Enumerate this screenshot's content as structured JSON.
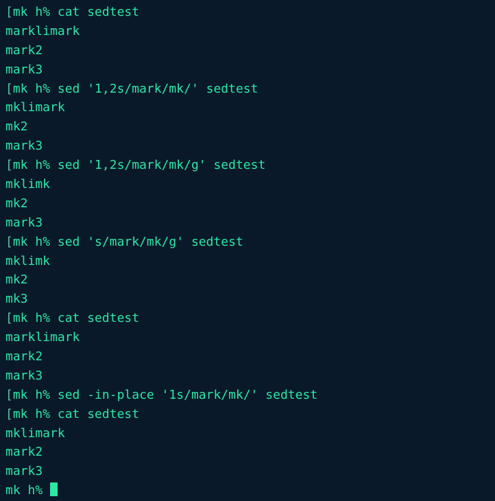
{
  "terminal": {
    "prompt_bracket": "[",
    "prompt_text": "mk h%",
    "lines": [
      {
        "type": "prompt",
        "command": "cat sedtest"
      },
      {
        "type": "output",
        "text": "marklimark"
      },
      {
        "type": "output",
        "text": "mark2"
      },
      {
        "type": "output",
        "text": "mark3"
      },
      {
        "type": "prompt",
        "command": "sed '1,2s/mark/mk/' sedtest"
      },
      {
        "type": "output",
        "text": "mklimark"
      },
      {
        "type": "output",
        "text": "mk2"
      },
      {
        "type": "output",
        "text": "mark3"
      },
      {
        "type": "prompt",
        "command": "sed '1,2s/mark/mk/g' sedtest"
      },
      {
        "type": "output",
        "text": "mklimk"
      },
      {
        "type": "output",
        "text": "mk2"
      },
      {
        "type": "output",
        "text": "mark3"
      },
      {
        "type": "prompt",
        "command": "sed 's/mark/mk/g' sedtest"
      },
      {
        "type": "output",
        "text": "mklimk"
      },
      {
        "type": "output",
        "text": "mk2"
      },
      {
        "type": "output",
        "text": "mk3"
      },
      {
        "type": "prompt",
        "command": "cat sedtest"
      },
      {
        "type": "output",
        "text": "marklimark"
      },
      {
        "type": "output",
        "text": "mark2"
      },
      {
        "type": "output",
        "text": "mark3"
      },
      {
        "type": "prompt",
        "command": "sed -in-place '1s/mark/mk/' sedtest"
      },
      {
        "type": "prompt",
        "command": "cat sedtest"
      },
      {
        "type": "output",
        "text": "mklimark"
      },
      {
        "type": "output",
        "text": "mark2"
      },
      {
        "type": "output",
        "text": "mark3"
      },
      {
        "type": "cursor",
        "command": ""
      }
    ]
  }
}
